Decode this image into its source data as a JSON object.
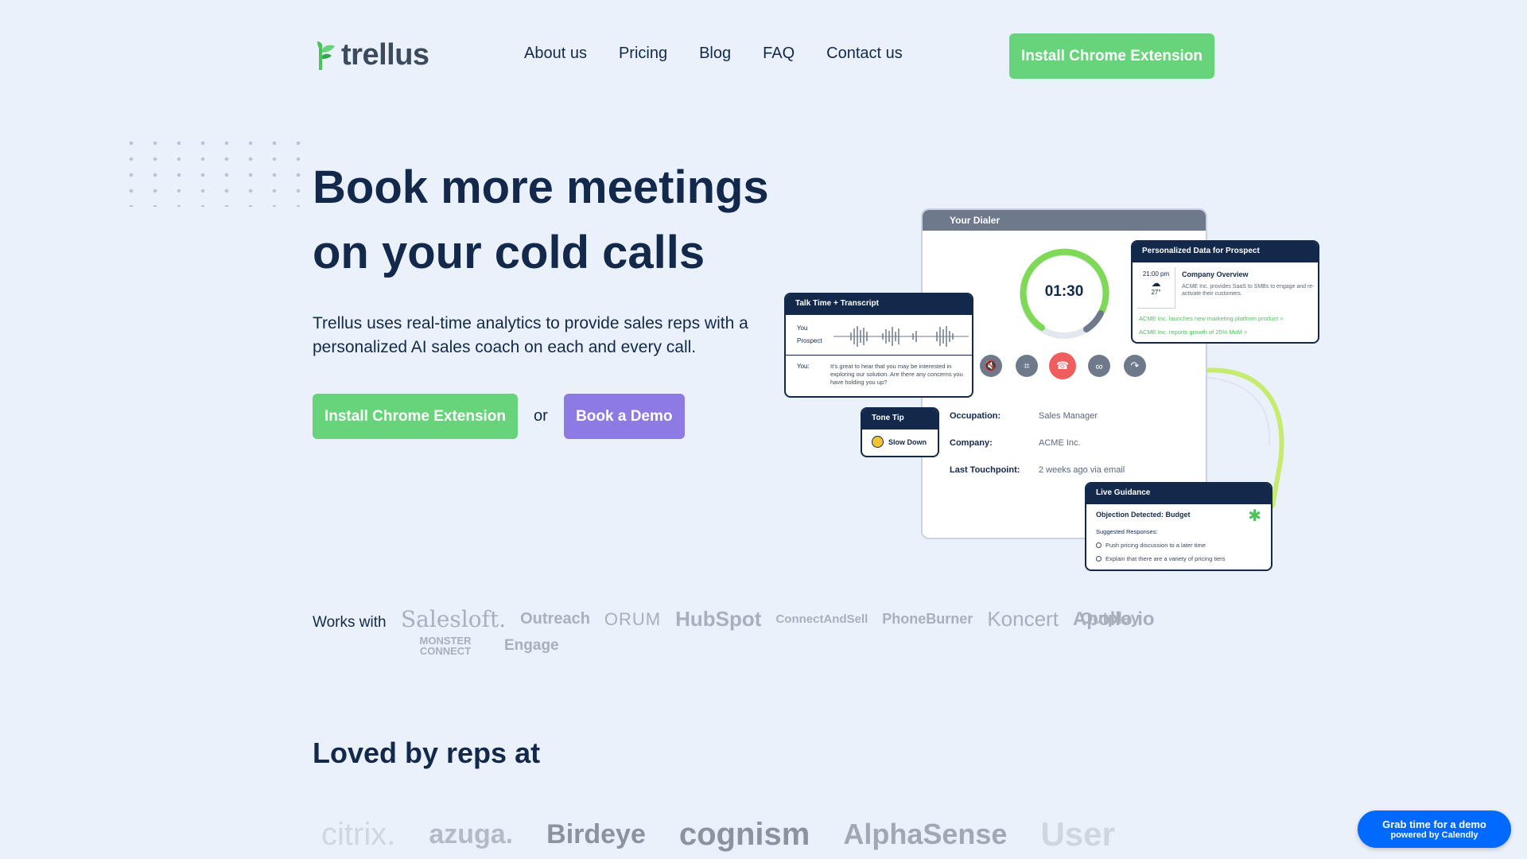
{
  "header": {
    "logo_text": "trellus",
    "nav": [
      "About us",
      "Pricing",
      "Blog",
      "FAQ",
      "Contact us"
    ],
    "cta_label": "Install Chrome Extension"
  },
  "hero": {
    "title_line1": "Book more meetings",
    "title_line2": "on your cold calls",
    "subtitle": "Trellus uses real-time analytics to provide sales reps with a personalized AI sales coach on each and every call.",
    "primary_cta": "Install Chrome Extension",
    "or_text": "or",
    "secondary_cta": "Book a Demo"
  },
  "illustration": {
    "dialer": {
      "title": "Your Dialer",
      "timer": "01:30",
      "occupation_label": "Occupation:",
      "occupation_value": "Sales Manager",
      "company_label": "Company:",
      "company_value": "ACME Inc.",
      "touchpoint_label": "Last Touchpoint:",
      "touchpoint_value": "2 weeks ago via email"
    },
    "talk": {
      "title": "Talk Time + Transcript",
      "you_label": "You",
      "prospect_label": "Prospect",
      "transcript_speaker": "You:",
      "transcript_text": "It's great to hear that you may be interested in exploring our solution. Are there any concerns you have holding you up?"
    },
    "tone": {
      "title": "Tone Tip",
      "tip": "Slow Down"
    },
    "personalized": {
      "title": "Personalized Data for Prospect",
      "time": "21:00 pm",
      "temp": "27°",
      "overview_title": "Company Overview",
      "overview_text": "ACME Inc. provides SaaS to SMBs to engage and re-activate their customers.",
      "news1": "ACME Inc. launches new marketing platform product  >",
      "news2": "ACME Inc. reports growth of 25% MoM  >"
    },
    "live": {
      "title": "Live Guidance",
      "objection": "Objection Detected: Budget",
      "suggested_label": "Suggested Responses:",
      "option1": "Push pricing discussion to a later time",
      "option2": "Explain that there are a variety of pricing tiers"
    }
  },
  "works_with": {
    "label": "Works with",
    "logos": [
      "Salesloft.",
      "Outreach",
      "ORUM",
      "HubSpot",
      "ConnectAndSell",
      "PhoneBurner",
      "Koncert",
      "Apollo.io",
      "Outplay",
      "MONSTER CONNECT",
      "Engage"
    ]
  },
  "loved_by": {
    "title": "Loved by reps at",
    "logos": [
      "citrix.",
      "azuga.",
      "Birdeye",
      "cognism",
      "AlphaSense",
      "User"
    ]
  },
  "calendly": {
    "line1": "Grab time for a demo",
    "line2": "powered by Calendly"
  },
  "colors": {
    "background": "#eaf1fa",
    "navy": "#13294b",
    "green": "#67d37a",
    "purple": "#8e7ae3",
    "calendly_blue": "#0069ff"
  }
}
